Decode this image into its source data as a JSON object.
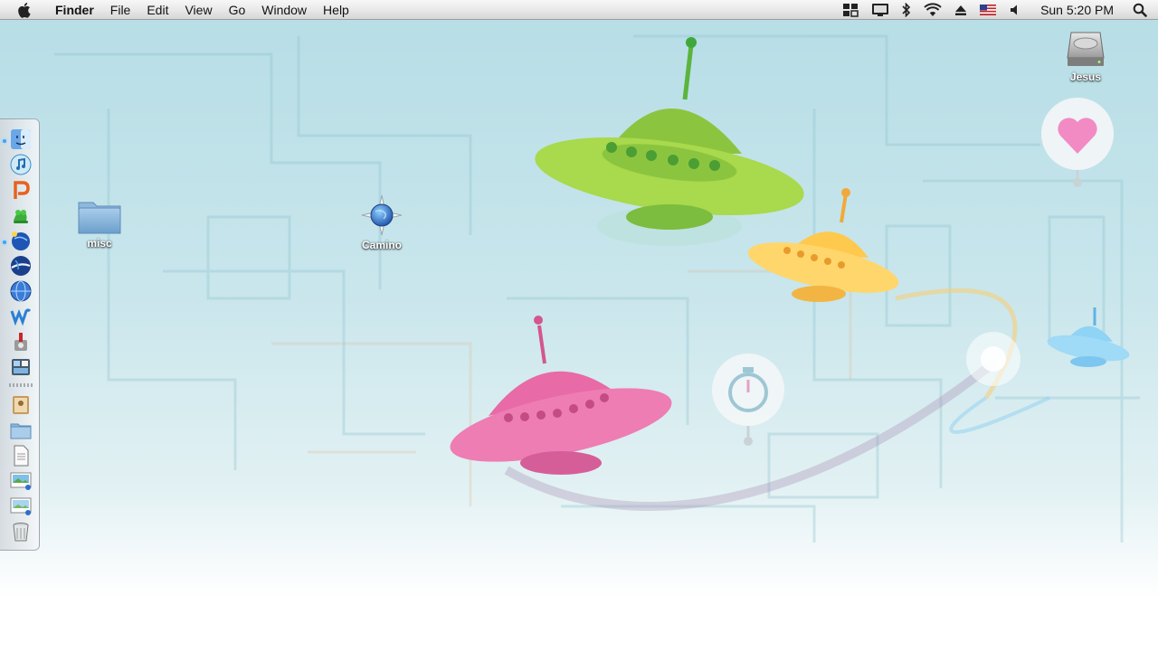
{
  "menubar": {
    "app_name": "Finder",
    "menus": [
      "File",
      "Edit",
      "View",
      "Go",
      "Window",
      "Help"
    ],
    "clock": "Sun 5:20 PM",
    "status_icons": [
      "spaces-icon",
      "display-icon",
      "bluetooth-icon",
      "wifi-icon",
      "eject-icon",
      "us-flag-input-icon",
      "volume-icon"
    ]
  },
  "desktop": {
    "icons": [
      {
        "label": "Jesus",
        "icon": "hard-drive-icon"
      },
      {
        "label": "misc",
        "icon": "folder-icon"
      },
      {
        "label": "Camino",
        "icon": "camino-app-icon"
      }
    ]
  },
  "dock": {
    "apps": [
      "finder-icon",
      "itunes-icon",
      "pages-icon",
      "frog-app-icon",
      "globe-app-icon",
      "google-earth-icon",
      "network-globe-icon",
      "dreamweaver-icon",
      "utility-app-icon",
      "dashboard-widgets-icon"
    ],
    "docs": [
      "address-book-icon",
      "folder-stack-icon",
      "document-icon",
      "image-document-icon",
      "image-document-2-icon",
      "trash-icon"
    ],
    "running": [
      "finder-icon",
      "globe-app-icon"
    ]
  },
  "colors": {
    "wallpaper_base": "#b6dde6",
    "ufo_green": "#8bc53f",
    "ufo_yellow": "#ffc94d",
    "ufo_pink": "#e86aa6",
    "ufo_blue": "#7cc6f0",
    "heart_pink": "#f28bc4"
  }
}
